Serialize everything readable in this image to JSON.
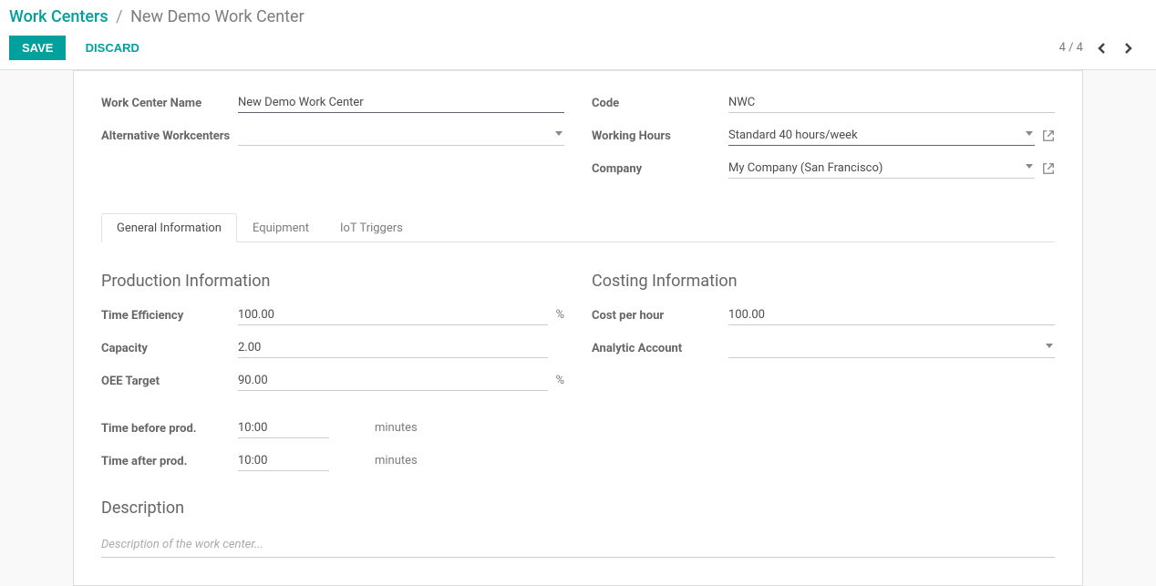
{
  "breadcrumb": {
    "root": "Work Centers",
    "current": "New Demo Work Center"
  },
  "buttons": {
    "save": "SAVE",
    "discard": "DISCARD"
  },
  "pager": {
    "text": "4 / 4"
  },
  "fields": {
    "work_center_name": {
      "label": "Work Center Name",
      "value": "New Demo Work Center"
    },
    "alternative_workcenters": {
      "label": "Alternative Workcenters",
      "value": ""
    },
    "code": {
      "label": "Code",
      "value": "NWC"
    },
    "working_hours": {
      "label": "Working Hours",
      "value": "Standard 40 hours/week"
    },
    "company": {
      "label": "Company",
      "value": "My Company (San Francisco)"
    }
  },
  "tabs": [
    {
      "label": "General Information"
    },
    {
      "label": "Equipment"
    },
    {
      "label": "IoT Triggers"
    }
  ],
  "sections": {
    "production": {
      "title": "Production Information",
      "time_efficiency": {
        "label": "Time Efficiency",
        "value": "100.00",
        "suffix": "%"
      },
      "capacity": {
        "label": "Capacity",
        "value": "2.00"
      },
      "oee_target": {
        "label": "OEE Target",
        "value": "90.00",
        "suffix": "%"
      },
      "time_before": {
        "label": "Time before prod.",
        "value": "10:00",
        "suffix": "minutes"
      },
      "time_after": {
        "label": "Time after prod.",
        "value": "10:00",
        "suffix": "minutes"
      }
    },
    "costing": {
      "title": "Costing Information",
      "cost_per_hour": {
        "label": "Cost per hour",
        "value": "100.00"
      },
      "analytic_account": {
        "label": "Analytic Account",
        "value": ""
      }
    },
    "description": {
      "title": "Description",
      "placeholder": "Description of the work center..."
    }
  }
}
